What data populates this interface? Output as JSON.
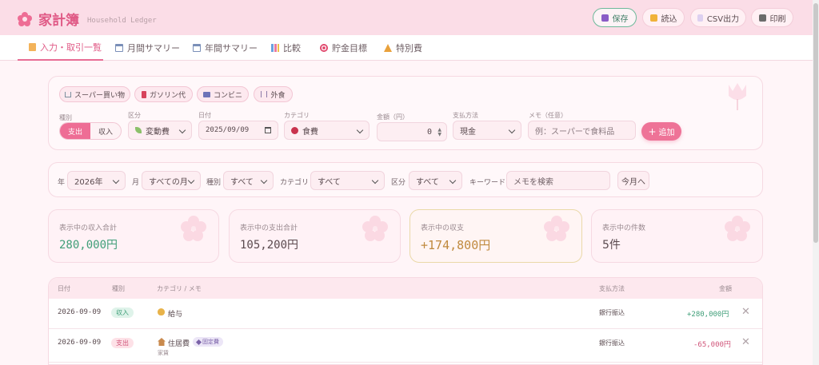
{
  "app": {
    "title": "家計簿",
    "subtitle": "Household Ledger"
  },
  "header_buttons": [
    {
      "label": "保存",
      "icon": "floppy-disk-icon",
      "color": "#8a5bc6"
    },
    {
      "label": "読込",
      "icon": "folder-icon",
      "color": "#f0b23a"
    },
    {
      "label": "CSV出力",
      "icon": "document-icon",
      "color": "#c9b2e6"
    },
    {
      "label": "印刷",
      "icon": "printer-icon",
      "color": "#6b6b6b"
    }
  ],
  "tabs": [
    {
      "label": "入力・取引一覧",
      "icon": "memo-icon",
      "active": true
    },
    {
      "label": "月間サマリー",
      "icon": "calendar-icon",
      "active": false
    },
    {
      "label": "年間サマリー",
      "icon": "calendar-icon",
      "active": false
    },
    {
      "label": "比較",
      "icon": "bar-chart-icon",
      "active": false
    },
    {
      "label": "貯金目標",
      "icon": "target-icon",
      "active": false
    },
    {
      "label": "特別費",
      "icon": "party-icon",
      "active": false
    }
  ],
  "quick_chips": [
    {
      "label": "スーパー買い物",
      "icon": "cart-icon"
    },
    {
      "label": "ガソリン代",
      "icon": "fuel-icon"
    },
    {
      "label": "コンビニ",
      "icon": "store-icon"
    },
    {
      "label": "外食",
      "icon": "cutlery-icon"
    }
  ],
  "form": {
    "type_label": "種別",
    "type_options": [
      "支出",
      "収入"
    ],
    "division_label": "区分",
    "division_value": "変動費",
    "date_label": "日付",
    "date_value": "2025/09/09",
    "category_label": "カテゴリ",
    "category_value": "食費",
    "amount_label": "金額（円）",
    "amount_value": "0",
    "payment_label": "支払方法",
    "payment_value": "現金",
    "memo_label": "メモ（任意）",
    "memo_placeholder": "例：スーパーで食料品",
    "add_label": "追加"
  },
  "filters": {
    "year_label": "年",
    "year_value": "2026年",
    "month_label": "月",
    "month_value": "すべての月",
    "type_label": "種別",
    "type_value": "すべて",
    "category_label": "カテゴリ",
    "category_value": "すべて",
    "division_label": "区分",
    "division_value": "すべて",
    "keyword_label": "キーワード",
    "keyword_placeholder": "メモを検索",
    "this_month_label": "今月へ"
  },
  "summary": [
    {
      "title": "表示中の収入合計",
      "value": "280,000円"
    },
    {
      "title": "表示中の支出合計",
      "value": "105,200円"
    },
    {
      "title": "表示中の収支",
      "value": "+174,800円"
    },
    {
      "title": "表示中の件数",
      "value": "5件"
    }
  ],
  "table": {
    "headers": [
      "日付",
      "種別",
      "カテゴリ / メモ",
      "支払方法",
      "金額"
    ],
    "rows": [
      {
        "date": "2026-09-09",
        "type": "収入",
        "category": "給与",
        "icon": "money-bag-icon",
        "memo": "",
        "fixed": "",
        "payment": "銀行振込",
        "amount": "+280,000円"
      },
      {
        "date": "2026-09-09",
        "type": "支出",
        "category": "住居費",
        "icon": "house-icon",
        "memo": "家賃",
        "fixed": "固定費",
        "payment": "銀行振込",
        "amount": "-65,000円"
      }
    ]
  },
  "colors": {
    "accent": "#ee6d95",
    "income": "#3f9e78",
    "expense": "#d0557a",
    "balance": "#c08a3f"
  }
}
